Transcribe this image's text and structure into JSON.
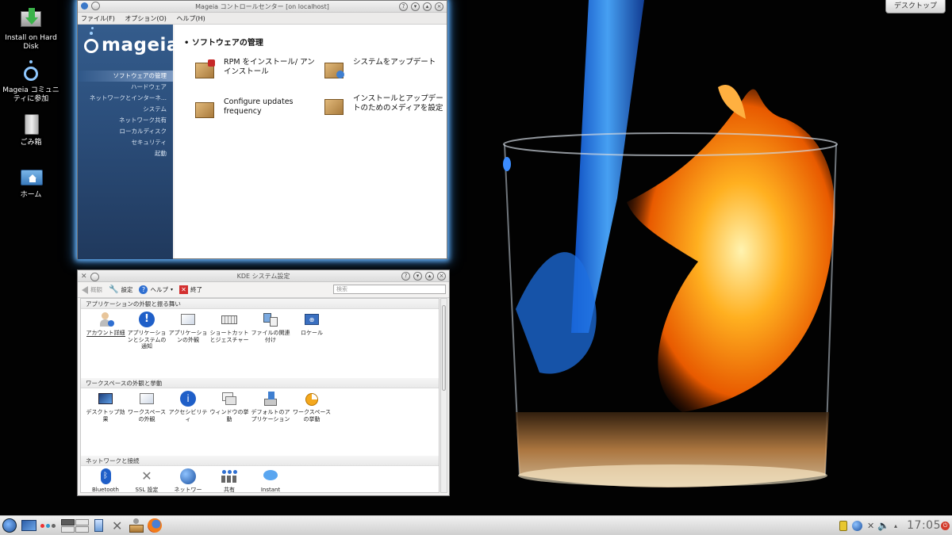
{
  "desktop": {
    "icons": [
      {
        "label": "Install on Hard Disk"
      },
      {
        "label": "Mageia コミュニティに参加"
      },
      {
        "label": "ごみ箱"
      },
      {
        "label": "ホーム"
      }
    ],
    "desktop_button": "デスクトップ"
  },
  "mcc": {
    "title": "Mageia コントロールセンター [on localhost]",
    "menu": [
      "ファイル(F)",
      "オプション(O)",
      "ヘルプ(H)"
    ],
    "logo": "mageia",
    "sidebar": [
      "ソフトウェアの管理",
      "ハードウェア",
      "ネットワークとインターネ...",
      "システム",
      "ネットワーク共有",
      "ローカルディスク",
      "セキュリティ",
      "起動"
    ],
    "heading": "• ソフトウェアの管理",
    "tiles": [
      "RPM をインストール/ アンインストール",
      "システムをアップデート",
      "Configure updates frequency",
      "インストールとアップデートのためのメディアを設定"
    ]
  },
  "kde": {
    "title": "KDE システム設定",
    "toolbar": {
      "back": "概観",
      "configure": "設定",
      "help": "ヘルプ",
      "quit": "終了"
    },
    "search_placeholder": "検索",
    "categories": [
      {
        "title": "アプリケーションの外観と振る舞い",
        "items": [
          "アカウント詳細",
          "アプリケーションとシステムの通知",
          "アプリケーションの外観",
          "ショートカットとジェスチャー",
          "ファイルの関連付け",
          "ロケール"
        ]
      },
      {
        "title": "ワークスペースの外観と挙動",
        "items": [
          "デスクトップ効果",
          "ワークスペースの外観",
          "アクセシビリティ",
          "ウィンドウの挙動",
          "デフォルトのアプリケーション",
          "ワークスペースの挙動"
        ]
      },
      {
        "title": "ネットワークと接続",
        "items": [
          "Bluetooth",
          "SSL 設定",
          "ネットワー",
          "共有",
          "Instant"
        ]
      }
    ]
  },
  "taskbar": {
    "clock": "17:05"
  },
  "colors": {
    "accent_glow": "#69b7ff",
    "sidebar": "#2c4f7c"
  }
}
